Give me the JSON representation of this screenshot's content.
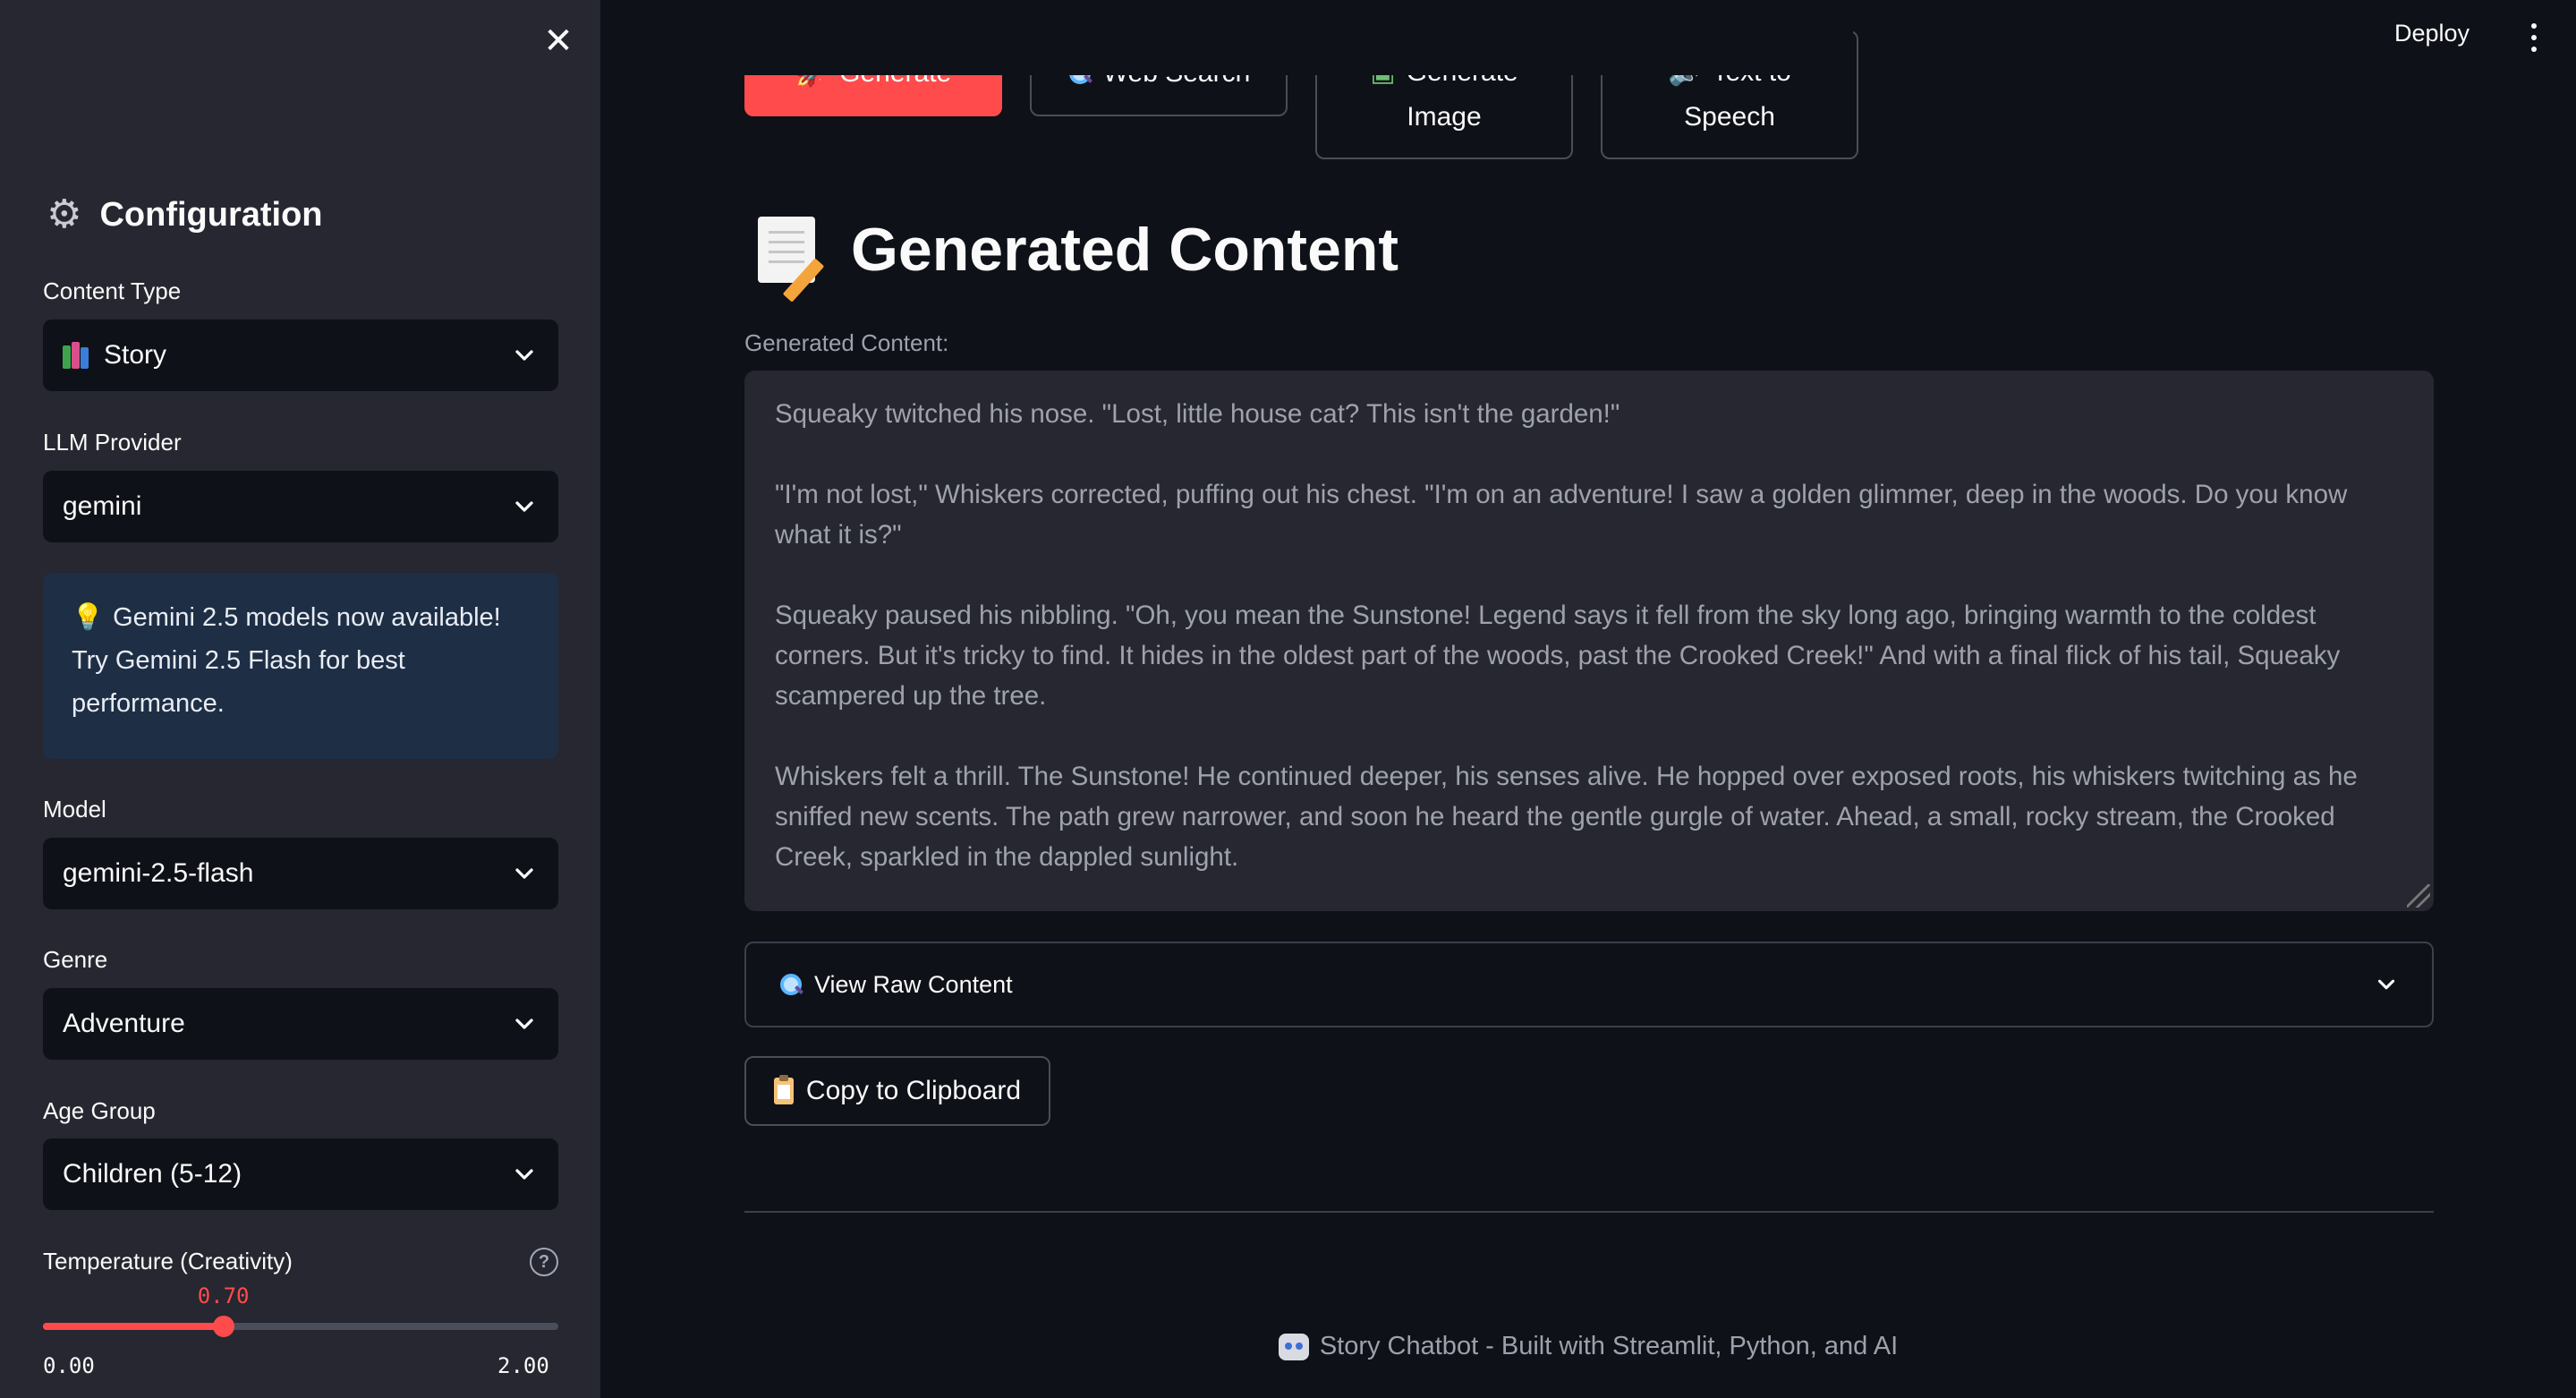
{
  "sidebar": {
    "title": "Configuration",
    "fields": {
      "content_type": {
        "label": "Content Type",
        "value": "Story"
      },
      "llm_provider": {
        "label": "LLM Provider",
        "value": "gemini"
      },
      "model": {
        "label": "Model",
        "value": "gemini-2.5-flash"
      },
      "genre": {
        "label": "Genre",
        "value": "Adventure"
      },
      "age_group": {
        "label": "Age Group",
        "value": "Children (5-12)"
      }
    },
    "info": {
      "line1": "Gemini 2.5 models now available!",
      "line2": "Try Gemini 2.5 Flash for best",
      "line3": "performance."
    },
    "temperature": {
      "label": "Temperature (Creativity)",
      "value": 0.7,
      "value_text": "0.70",
      "min": 0.0,
      "max": 2.0,
      "min_text": "0.00",
      "max_text": "2.00"
    }
  },
  "topbar": {
    "deploy": "Deploy"
  },
  "tabs": {
    "generate": "Generate",
    "web_search": "Web Search",
    "generate_image_1": "Generate",
    "generate_image_2": "Image",
    "tts_1": "Text to",
    "tts_2": "Speech"
  },
  "main": {
    "title": "Generated Content",
    "textarea_label": "Generated Content:",
    "paragraphs": [
      "Squeaky twitched his nose. \"Lost, little house cat? This isn't the garden!\"",
      "\"I'm not lost,\" Whiskers corrected, puffing out his chest. \"I'm on an adventure! I saw a golden glimmer, deep in the woods. Do you know what it is?\"",
      "Squeaky paused his nibbling. \"Oh, you mean the Sunstone! Legend says it fell from the sky long ago, bringing warmth to the coldest corners. But it's tricky to find. It hides in the oldest part of the woods, past the Crooked Creek!\" And with a final flick of his tail, Squeaky scampered up the tree.",
      "Whiskers felt a thrill. The Sunstone! He continued deeper, his senses alive. He hopped over exposed roots, his whiskers twitching as he sniffed new scents. The path grew narrower, and soon he heard the gentle gurgle of water. Ahead, a small, rocky stream, the Crooked Creek, sparkled in the dappled sunlight."
    ],
    "expander_label": "View Raw Content",
    "copy_label": "Copy to Clipboard",
    "footer": "Story Chatbot - Built with Streamlit, Python, and AI"
  },
  "colors": {
    "primary": "#ff4b4b",
    "sidebar_bg": "#262730",
    "app_bg": "#0e1117",
    "info_bg": "#1e2e45"
  }
}
